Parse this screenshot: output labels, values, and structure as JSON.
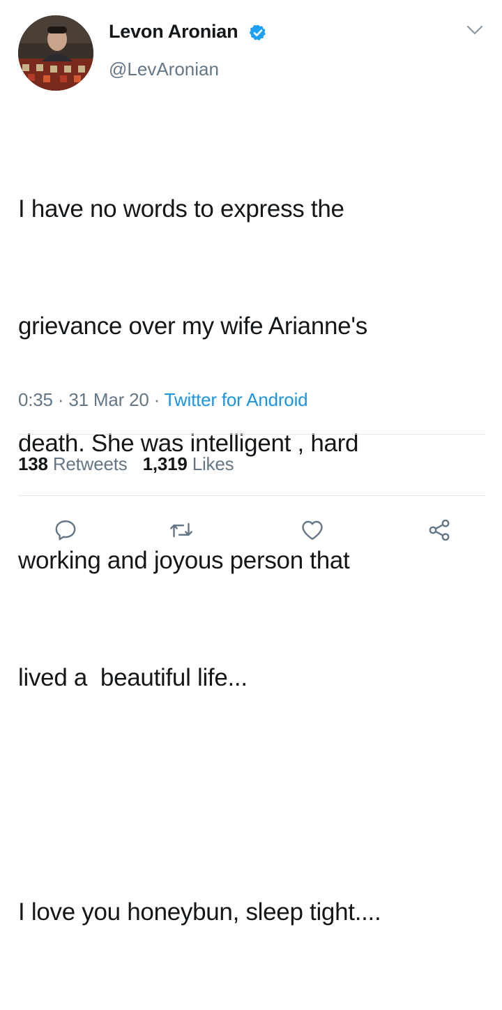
{
  "user": {
    "display_name": "Levon Aronian",
    "handle": "@LevAronian",
    "verified": true,
    "verified_icon": "verified-badge-icon",
    "avatar_icon": "avatar"
  },
  "tweet": {
    "lines": [
      "I have no words to express the",
      "grievance over my wife Arianne's",
      "death. She was intelligent , hard",
      "working and joyous person that",
      "lived a  beautiful life..."
    ],
    "last_line": "I love you honeybun, sleep tight....",
    "time": "0:35",
    "date": "31 Mar 20",
    "separator": "·",
    "source": "Twitter for Android"
  },
  "stats": {
    "retweets_count": "138",
    "retweets_label": "Retweets",
    "likes_count": "1,319",
    "likes_label": "Likes"
  },
  "actions": [
    "reply-icon",
    "retweet-icon",
    "like-icon",
    "share-icon"
  ],
  "colors": {
    "text": "#14171a",
    "secondary": "#657786",
    "link": "#1b95e0",
    "verified": "#1da1f2",
    "divider": "#e1e8ed"
  }
}
